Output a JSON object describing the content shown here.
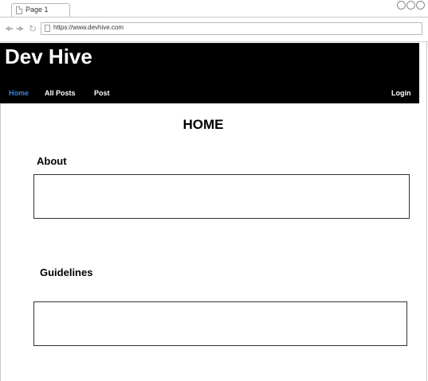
{
  "browser": {
    "tab_label": "Page 1",
    "url": "https://www.devhive.com"
  },
  "site": {
    "title": "Dev Hive",
    "nav": {
      "home": "Home",
      "all_posts": "All Posts",
      "post": "Post",
      "login": "Login"
    },
    "accent_color": "#3a86d8"
  },
  "main": {
    "page_title": "HOME",
    "about_heading": "About",
    "guidelines_heading": "Guidelines"
  }
}
